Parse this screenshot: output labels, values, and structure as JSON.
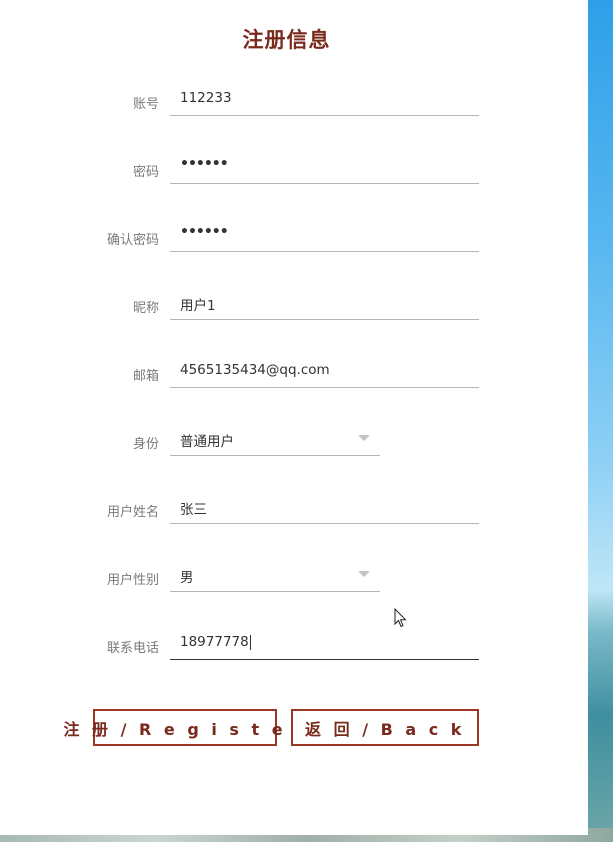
{
  "title": "注册信息",
  "fields": [
    {
      "label": "账号",
      "value": "112233"
    },
    {
      "label": "密码",
      "value": "••••••"
    },
    {
      "label": "确认密码",
      "value": "••••••"
    },
    {
      "label": "昵称",
      "value": "用户1"
    },
    {
      "label": "邮箱",
      "value": "4565135434@qq.com"
    },
    {
      "label": "身份",
      "value": "普通用户"
    },
    {
      "label": "用户姓名",
      "value": "张三"
    },
    {
      "label": "用户性别",
      "value": "男"
    },
    {
      "label": "联系电话",
      "value": "18977778"
    }
  ],
  "buttons": {
    "register": "注 册 / R e g i s t e r",
    "back": "返 回 / B a c k"
  },
  "colors": {
    "accent": "#7a2a1c",
    "button_border": "#9b3626"
  },
  "icons": {
    "dropdown": "chevron-down-icon",
    "pointer": "mouse-pointer-icon"
  }
}
